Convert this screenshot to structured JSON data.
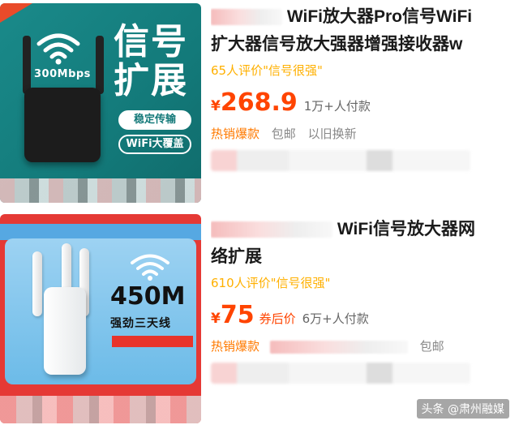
{
  "products": [
    {
      "image": {
        "mbps": "300Mbps",
        "headline": "信号扩展",
        "tag1": "稳定传输",
        "tag2": "WiFi大覆盖"
      },
      "title_line1": "WiFi放大器Pro信号WiFi",
      "title_line2": "扩大器信号放大强器增强接收器w",
      "reviews": "65人评价\"信号很强\"",
      "currency": "¥",
      "price": "268.9",
      "coupon": "",
      "sold": "1万+人付款",
      "tags": [
        "热销爆款"
      ],
      "grey_tags": [
        "包邮",
        "以旧换新"
      ]
    },
    {
      "image": {
        "speed": "450M",
        "desc": "强劲三天线"
      },
      "title_line1": "WiFi信号放大器网",
      "title_line2": "络扩展",
      "reviews": "610人评价\"信号很强\"",
      "currency": "¥",
      "price": "75",
      "coupon": "券后价",
      "sold": "6万+人付款",
      "tags": [
        "热销爆款"
      ],
      "grey_tags": [
        "包邮"
      ]
    }
  ],
  "watermark": "头条 @肃州融媒",
  "colors": {
    "price": "#ff4400",
    "review": "#ffb000",
    "tag": "#ff7a00"
  }
}
